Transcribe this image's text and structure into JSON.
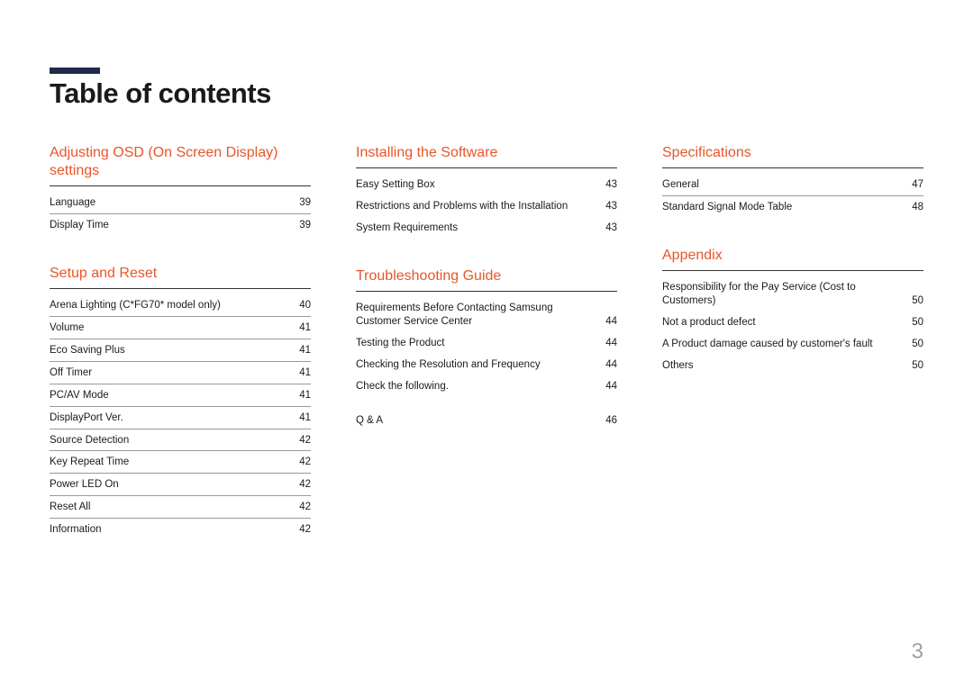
{
  "page_title": "Table of contents",
  "page_number": "3",
  "columns": [
    {
      "sections": [
        {
          "heading": "Adjusting OSD (On Screen Display) settings",
          "groups": [
            {
              "entries": [
                {
                  "label": "Language",
                  "page": "39",
                  "ruled": true
                },
                {
                  "label": "Display Time",
                  "page": "39",
                  "ruled": false
                }
              ]
            }
          ]
        },
        {
          "heading": "Setup and Reset",
          "groups": [
            {
              "entries": [
                {
                  "label": "Arena Lighting (C*FG70* model only)",
                  "page": "40",
                  "ruled": true
                },
                {
                  "label": "Volume",
                  "page": "41",
                  "ruled": true
                },
                {
                  "label": "Eco Saving Plus",
                  "page": "41",
                  "ruled": true
                },
                {
                  "label": "Off Timer",
                  "page": "41",
                  "ruled": true
                },
                {
                  "label": "PC/AV Mode",
                  "page": "41",
                  "ruled": true
                },
                {
                  "label": "DisplayPort Ver.",
                  "page": "41",
                  "ruled": true
                },
                {
                  "label": "Source Detection",
                  "page": "42",
                  "ruled": true
                },
                {
                  "label": "Key Repeat Time",
                  "page": "42",
                  "ruled": true
                },
                {
                  "label": "Power LED On",
                  "page": "42",
                  "ruled": true
                },
                {
                  "label": "Reset All",
                  "page": "42",
                  "ruled": true
                },
                {
                  "label": "Information",
                  "page": "42",
                  "ruled": false
                }
              ]
            }
          ]
        }
      ]
    },
    {
      "sections": [
        {
          "heading": "Installing the Software",
          "groups": [
            {
              "entries": [
                {
                  "label": "Easy Setting Box",
                  "page": "43",
                  "ruled": false
                },
                {
                  "label": "Restrictions and Problems with the Installation",
                  "page": "43",
                  "ruled": false
                },
                {
                  "label": "System Requirements",
                  "page": "43",
                  "ruled": false
                }
              ]
            }
          ]
        },
        {
          "heading": "Troubleshooting Guide",
          "groups": [
            {
              "entries": [
                {
                  "label": "Requirements Before Contacting Samsung Customer Service Center",
                  "page": "44",
                  "ruled": false
                },
                {
                  "label": "Testing the Product",
                  "page": "44",
                  "ruled": false
                },
                {
                  "label": "Checking the Resolution and Frequency",
                  "page": "44",
                  "ruled": false
                },
                {
                  "label": "Check the following.",
                  "page": "44",
                  "ruled": false
                }
              ]
            },
            {
              "entries": [
                {
                  "label": "Q & A",
                  "page": "46",
                  "ruled": false
                }
              ]
            }
          ]
        }
      ]
    },
    {
      "sections": [
        {
          "heading": "Specifications",
          "groups": [
            {
              "entries": [
                {
                  "label": "General",
                  "page": "47",
                  "ruled": true
                },
                {
                  "label": "Standard Signal Mode Table",
                  "page": "48",
                  "ruled": false
                }
              ]
            }
          ]
        },
        {
          "heading": "Appendix",
          "groups": [
            {
              "entries": [
                {
                  "label": "Responsibility for the Pay Service (Cost to Customers)",
                  "page": "50",
                  "ruled": false
                },
                {
                  "label": "Not a product defect",
                  "page": "50",
                  "ruled": false
                },
                {
                  "label": "A Product damage caused by customer's fault",
                  "page": "50",
                  "ruled": false
                },
                {
                  "label": "Others",
                  "page": "50",
                  "ruled": false
                }
              ]
            }
          ]
        }
      ]
    }
  ]
}
